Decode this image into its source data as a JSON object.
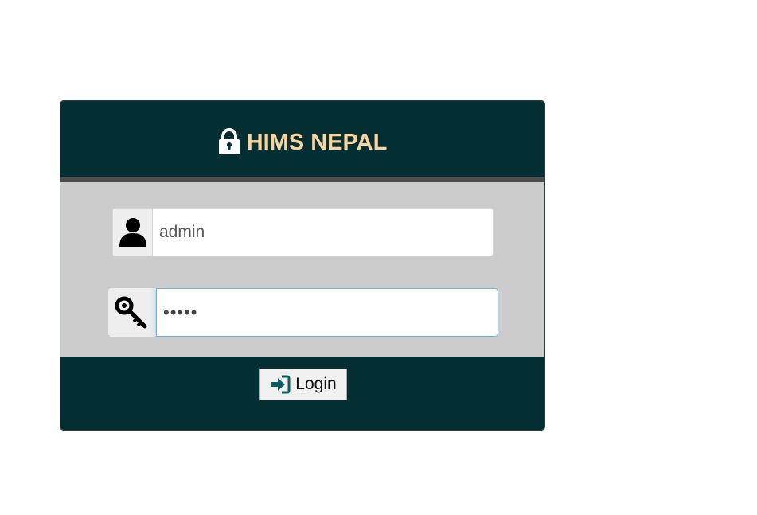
{
  "header": {
    "title": "HIMS NEPAL",
    "icon": "lock-icon"
  },
  "form": {
    "username": {
      "icon": "user-icon",
      "value": "admin"
    },
    "password": {
      "icon": "key-icon",
      "value": "•••••"
    },
    "login_button": {
      "icon": "sign-in-icon",
      "label": "Login"
    }
  },
  "colors": {
    "panel_dark": "#032f33",
    "title": "#fad49e",
    "body_bg": "#cccccc",
    "divider": "#4d4d4d",
    "focus_border": "#66afe9",
    "login_icon": "#0b5f5f"
  }
}
